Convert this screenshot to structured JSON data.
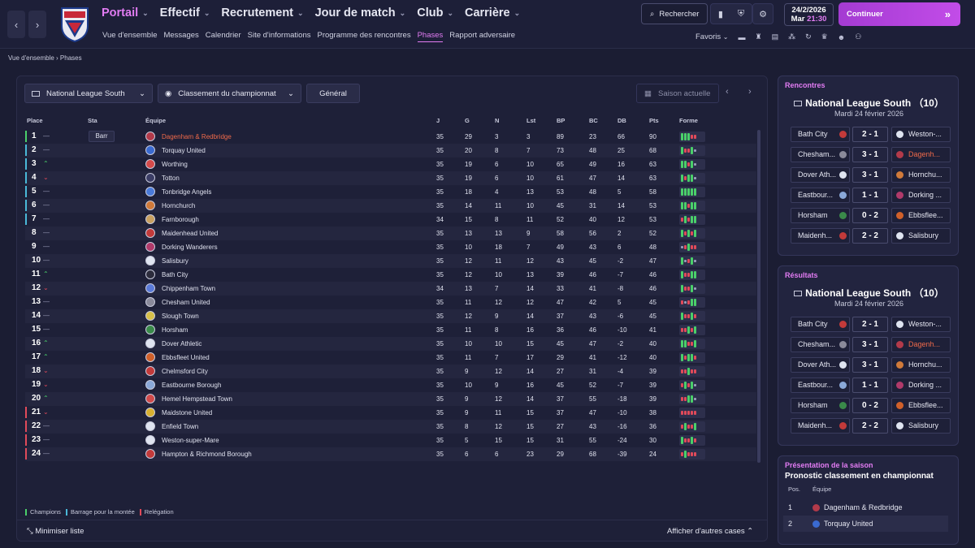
{
  "nav": {
    "main": [
      {
        "label": "Portail",
        "active": true
      },
      {
        "label": "Effectif",
        "active": false
      },
      {
        "label": "Recrutement",
        "active": false
      },
      {
        "label": "Jour de match",
        "active": false
      },
      {
        "label": "Club",
        "active": false
      },
      {
        "label": "Carrière",
        "active": false
      }
    ],
    "sub": [
      {
        "label": "Vue d'ensemble",
        "active": false
      },
      {
        "label": "Messages",
        "active": false
      },
      {
        "label": "Calendrier",
        "active": false
      },
      {
        "label": "Site d'informations",
        "active": false
      },
      {
        "label": "Programme des rencontres",
        "active": false
      },
      {
        "label": "Phases",
        "active": true
      },
      {
        "label": "Rapport adversaire",
        "active": false
      }
    ]
  },
  "header": {
    "search": "Rechercher",
    "date": "24/2/2026",
    "day": "Mar",
    "time": "21:30",
    "continue": "Continuer",
    "favorites": "Favoris"
  },
  "breadcrumb": "Vue d'ensemble › Phases",
  "filters": {
    "competition": "National League South",
    "view": "Classement du championnat",
    "scope": "Général",
    "season": "Saison actuelle"
  },
  "table": {
    "columns": [
      "Place",
      "Sta",
      "Équipe",
      "J",
      "G",
      "N",
      "Lst",
      "BP",
      "BC",
      "DB",
      "Pts",
      "Forme"
    ],
    "rows": [
      {
        "pos": "1",
        "trend": "flat",
        "status": "Barr",
        "team": "Dagenham & Redbridge",
        "highlight": true,
        "j": "35",
        "g": "29",
        "n": "3",
        "l": "3",
        "bp": "89",
        "bc": "23",
        "db": "66",
        "pts": "90",
        "marker": "champion",
        "color": "#b23a4a",
        "form": "WWWLL"
      },
      {
        "pos": "2",
        "trend": "flat",
        "status": "",
        "team": "Torquay United",
        "j": "35",
        "g": "20",
        "n": "8",
        "l": "7",
        "bp": "73",
        "bc": "48",
        "db": "25",
        "pts": "68",
        "marker": "playoff",
        "color": "#3a6ad0",
        "form": "WLLWD"
      },
      {
        "pos": "3",
        "trend": "up",
        "status": "",
        "team": "Worthing",
        "j": "35",
        "g": "19",
        "n": "6",
        "l": "10",
        "bp": "65",
        "bc": "49",
        "db": "16",
        "pts": "63",
        "marker": "playoff",
        "color": "#d44a4a",
        "form": "WWLWD"
      },
      {
        "pos": "4",
        "trend": "down",
        "status": "",
        "team": "Totton",
        "j": "35",
        "g": "19",
        "n": "6",
        "l": "10",
        "bp": "61",
        "bc": "47",
        "db": "14",
        "pts": "63",
        "marker": "playoff",
        "color": "#3b3d66",
        "form": "WLWWD"
      },
      {
        "pos": "5",
        "trend": "flat",
        "status": "",
        "team": "Tonbridge Angels",
        "j": "35",
        "g": "18",
        "n": "4",
        "l": "13",
        "bp": "53",
        "bc": "48",
        "db": "5",
        "pts": "58",
        "marker": "playoff",
        "color": "#4a7ad8",
        "form": "WWWWW"
      },
      {
        "pos": "6",
        "trend": "flat",
        "status": "",
        "team": "Hornchurch",
        "j": "35",
        "g": "14",
        "n": "11",
        "l": "10",
        "bp": "45",
        "bc": "31",
        "db": "14",
        "pts": "53",
        "marker": "playoff",
        "color": "#d07a3a",
        "form": "WWLWW"
      },
      {
        "pos": "7",
        "trend": "flat",
        "status": "",
        "team": "Farnborough",
        "j": "34",
        "g": "15",
        "n": "8",
        "l": "11",
        "bp": "52",
        "bc": "40",
        "db": "12",
        "pts": "53",
        "marker": "playoff",
        "color": "#c8a060",
        "form": "LWLWW"
      },
      {
        "pos": "8",
        "trend": "flat",
        "status": "",
        "team": "Maidenhead United",
        "j": "35",
        "g": "13",
        "n": "13",
        "l": "9",
        "bp": "58",
        "bc": "56",
        "db": "2",
        "pts": "52",
        "marker": "none",
        "color": "#c23a3a",
        "form": "WLWLW"
      },
      {
        "pos": "9",
        "trend": "flat",
        "status": "",
        "team": "Dorking Wanderers",
        "j": "35",
        "g": "10",
        "n": "18",
        "l": "7",
        "bp": "49",
        "bc": "43",
        "db": "6",
        "pts": "48",
        "marker": "none",
        "color": "#b03a6a",
        "form": "DLWLL"
      },
      {
        "pos": "10",
        "trend": "flat",
        "status": "",
        "team": "Salisbury",
        "j": "35",
        "g": "12",
        "n": "11",
        "l": "12",
        "bp": "43",
        "bc": "45",
        "db": "-2",
        "pts": "47",
        "marker": "none",
        "color": "#dfe4f0",
        "form": "WDLWD"
      },
      {
        "pos": "11",
        "trend": "up",
        "status": "",
        "team": "Bath City",
        "j": "35",
        "g": "12",
        "n": "10",
        "l": "13",
        "bp": "39",
        "bc": "46",
        "db": "-7",
        "pts": "46",
        "marker": "none",
        "color": "#2c2c3c",
        "form": "WLLWW"
      },
      {
        "pos": "12",
        "trend": "down",
        "status": "",
        "team": "Chippenham Town",
        "j": "34",
        "g": "13",
        "n": "7",
        "l": "14",
        "bp": "33",
        "bc": "41",
        "db": "-8",
        "pts": "46",
        "marker": "none",
        "color": "#5a7ad8",
        "form": "WLLWD"
      },
      {
        "pos": "13",
        "trend": "flat",
        "status": "",
        "team": "Chesham United",
        "j": "35",
        "g": "11",
        "n": "12",
        "l": "12",
        "bp": "47",
        "bc": "42",
        "db": "5",
        "pts": "45",
        "marker": "none",
        "color": "#8a8a9a",
        "form": "LDLWW"
      },
      {
        "pos": "14",
        "trend": "flat",
        "status": "",
        "team": "Slough Town",
        "j": "35",
        "g": "12",
        "n": "9",
        "l": "14",
        "bp": "37",
        "bc": "43",
        "db": "-6",
        "pts": "45",
        "marker": "none",
        "color": "#d8c04a",
        "form": "WLLWL"
      },
      {
        "pos": "15",
        "trend": "flat",
        "status": "",
        "team": "Horsham",
        "j": "35",
        "g": "11",
        "n": "8",
        "l": "16",
        "bp": "36",
        "bc": "46",
        "db": "-10",
        "pts": "41",
        "marker": "none",
        "color": "#3a8a4a",
        "form": "LLWLW"
      },
      {
        "pos": "16",
        "trend": "up",
        "status": "",
        "team": "Dover Athletic",
        "j": "35",
        "g": "10",
        "n": "10",
        "l": "15",
        "bp": "45",
        "bc": "47",
        "db": "-2",
        "pts": "40",
        "marker": "none",
        "color": "#dfe4f0",
        "form": "WWLLW"
      },
      {
        "pos": "17",
        "trend": "up",
        "status": "",
        "team": "Ebbsfleet United",
        "j": "35",
        "g": "11",
        "n": "7",
        "l": "17",
        "bp": "29",
        "bc": "41",
        "db": "-12",
        "pts": "40",
        "marker": "none",
        "color": "#d0602a",
        "form": "WLWWL"
      },
      {
        "pos": "18",
        "trend": "down",
        "status": "",
        "team": "Chelmsford City",
        "j": "35",
        "g": "9",
        "n": "12",
        "l": "14",
        "bp": "27",
        "bc": "31",
        "db": "-4",
        "pts": "39",
        "marker": "none",
        "color": "#c23a3a",
        "form": "LLWLL"
      },
      {
        "pos": "19",
        "trend": "down",
        "status": "",
        "team": "Eastbourne Borough",
        "j": "35",
        "g": "10",
        "n": "9",
        "l": "16",
        "bp": "45",
        "bc": "52",
        "db": "-7",
        "pts": "39",
        "marker": "none",
        "color": "#8aa8d8",
        "form": "LWLWD"
      },
      {
        "pos": "20",
        "trend": "up",
        "status": "",
        "team": "Hemel Hempstead Town",
        "j": "35",
        "g": "9",
        "n": "12",
        "l": "14",
        "bp": "37",
        "bc": "55",
        "db": "-18",
        "pts": "39",
        "marker": "none",
        "color": "#d04a4a",
        "form": "LLWWD"
      },
      {
        "pos": "21",
        "trend": "down",
        "status": "",
        "team": "Maidstone United",
        "j": "35",
        "g": "9",
        "n": "11",
        "l": "15",
        "bp": "37",
        "bc": "47",
        "db": "-10",
        "pts": "38",
        "marker": "relegation",
        "color": "#d8b030",
        "form": "LLLLL"
      },
      {
        "pos": "22",
        "trend": "flat",
        "status": "",
        "team": "Enfield Town",
        "j": "35",
        "g": "8",
        "n": "12",
        "l": "15",
        "bp": "27",
        "bc": "43",
        "db": "-16",
        "pts": "36",
        "marker": "relegation",
        "color": "#dfe4f0",
        "form": "LWLLW"
      },
      {
        "pos": "23",
        "trend": "flat",
        "status": "",
        "team": "Weston-super-Mare",
        "j": "35",
        "g": "5",
        "n": "15",
        "l": "15",
        "bp": "31",
        "bc": "55",
        "db": "-24",
        "pts": "30",
        "marker": "relegation",
        "color": "#dfe4f0",
        "form": "WLLWL"
      },
      {
        "pos": "24",
        "trend": "flat",
        "status": "",
        "team": "Hampton & Richmond Borough",
        "j": "35",
        "g": "6",
        "n": "6",
        "l": "23",
        "bp": "29",
        "bc": "68",
        "db": "-39",
        "pts": "24",
        "marker": "relegation",
        "color": "#c23a3a",
        "form": "LWLLL"
      }
    ]
  },
  "legend": {
    "champions": "Champions",
    "playoff": "Barrage pour la montée",
    "relegation": "Relégation"
  },
  "footer": {
    "minimize": "Minimiser liste",
    "more": "Afficher d'autres cases"
  },
  "fixtures": {
    "title": "Rencontres",
    "league": "National League South （10）",
    "date": "Mardi 24 février 2026",
    "matches": [
      {
        "home": "Bath City",
        "score": "2 - 1",
        "away": "Weston-...",
        "hc": "#c23a3a",
        "ac": "#dfe4f0",
        "hl": ""
      },
      {
        "home": "Chesham...",
        "score": "3 - 1",
        "away": "Dagenh...",
        "hc": "#8a8a9a",
        "ac": "#b23a4a",
        "hl": "away"
      },
      {
        "home": "Dover Ath...",
        "score": "3 - 1",
        "away": "Hornchu...",
        "hc": "#dfe4f0",
        "ac": "#d07a3a",
        "hl": ""
      },
      {
        "home": "Eastbour...",
        "score": "1 - 1",
        "away": "Dorking ...",
        "hc": "#8aa8d8",
        "ac": "#b03a6a",
        "hl": ""
      },
      {
        "home": "Horsham",
        "score": "0 - 2",
        "away": "Ebbsflee...",
        "hc": "#3a8a4a",
        "ac": "#d0602a",
        "hl": ""
      },
      {
        "home": "Maidenh...",
        "score": "2 - 2",
        "away": "Salisbury",
        "hc": "#c23a3a",
        "ac": "#dfe4f0",
        "hl": ""
      }
    ]
  },
  "results": {
    "title": "Résultats",
    "league": "National League South （10）",
    "date": "Mardi 24 février 2026",
    "matches": [
      {
        "home": "Bath City",
        "score": "2 - 1",
        "away": "Weston-...",
        "hc": "#c23a3a",
        "ac": "#dfe4f0",
        "hl": ""
      },
      {
        "home": "Chesham...",
        "score": "3 - 1",
        "away": "Dagenh...",
        "hc": "#8a8a9a",
        "ac": "#b23a4a",
        "hl": "away"
      },
      {
        "home": "Dover Ath...",
        "score": "3 - 1",
        "away": "Hornchu...",
        "hc": "#dfe4f0",
        "ac": "#d07a3a",
        "hl": ""
      },
      {
        "home": "Eastbour...",
        "score": "1 - 1",
        "away": "Dorking ...",
        "hc": "#8aa8d8",
        "ac": "#b03a6a",
        "hl": ""
      },
      {
        "home": "Horsham",
        "score": "0 - 2",
        "away": "Ebbsflee...",
        "hc": "#3a8a4a",
        "ac": "#d0602a",
        "hl": ""
      },
      {
        "home": "Maidenh...",
        "score": "2 - 2",
        "away": "Salisbury",
        "hc": "#c23a3a",
        "ac": "#dfe4f0",
        "hl": ""
      }
    ]
  },
  "season": {
    "title": "Présentation de la saison",
    "subtitle": "Pronostic classement en championnat",
    "col_pos": "Pos.",
    "col_team": "Équipe",
    "rows": [
      {
        "pos": "1",
        "team": "Dagenham & Redbridge",
        "color": "#b23a4a"
      },
      {
        "pos": "2",
        "team": "Torquay United",
        "color": "#3a6ad0"
      }
    ]
  },
  "colors": {
    "accent": "#e27cf3",
    "win": "#4ad06a",
    "loss": "#e04a5a",
    "draw": "#9a9cb8",
    "champion": "#4ad06a",
    "playoff": "#4ab8d8",
    "relegation": "#e04a5a",
    "highlight": "#f06a4a"
  }
}
